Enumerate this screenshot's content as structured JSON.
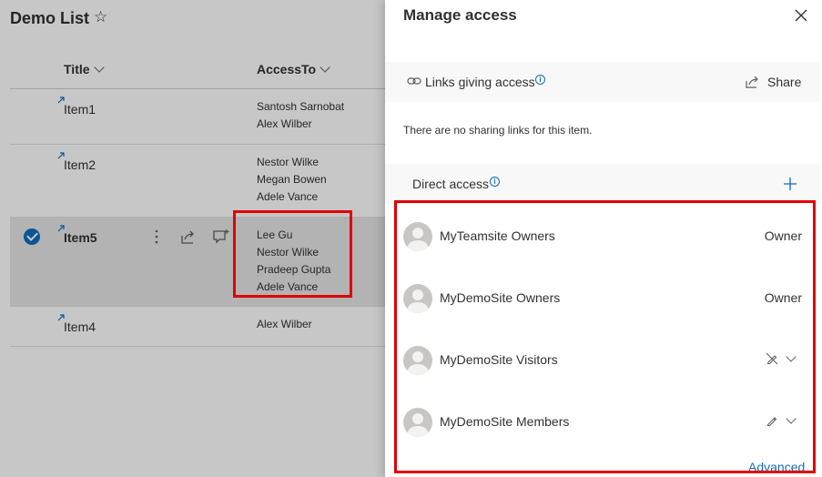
{
  "list": {
    "title": "Demo List",
    "columns": [
      {
        "label": "Title"
      },
      {
        "label": "AccessTo"
      }
    ],
    "rows": [
      {
        "title": "Item1",
        "people": [
          "Santosh Sarnobat",
          "Alex Wilber"
        ],
        "selected": false
      },
      {
        "title": "Item2",
        "people": [
          "Nestor Wilke",
          "Megan Bowen",
          "Adele Vance"
        ],
        "selected": false
      },
      {
        "title": "Item5",
        "people": [
          "Lee Gu",
          "Nestor Wilke",
          "Pradeep Gupta",
          "Adele Vance"
        ],
        "selected": true
      },
      {
        "title": "Item4",
        "people": [
          "Alex Wilber"
        ],
        "selected": false
      }
    ]
  },
  "panel": {
    "title": "Manage access",
    "links_section": {
      "label": "Links giving access",
      "share_label": "Share",
      "empty_message": "There are no sharing links for this item."
    },
    "direct_section": {
      "label": "Direct access",
      "entries": [
        {
          "name": "MyTeamsite Owners",
          "role": "Owner"
        },
        {
          "name": "MyDemoSite Owners",
          "role": "Owner"
        },
        {
          "name": "MyDemoSite Visitors",
          "role_icon": "no-edit-icon"
        },
        {
          "name": "MyDemoSite Members",
          "role_icon": "edit-pencil-icon"
        }
      ]
    },
    "advanced_label": "Advanced"
  },
  "colors": {
    "accent": "#0f6cbd",
    "highlight": "#e00000",
    "selected_row": "#e6e6e6"
  }
}
